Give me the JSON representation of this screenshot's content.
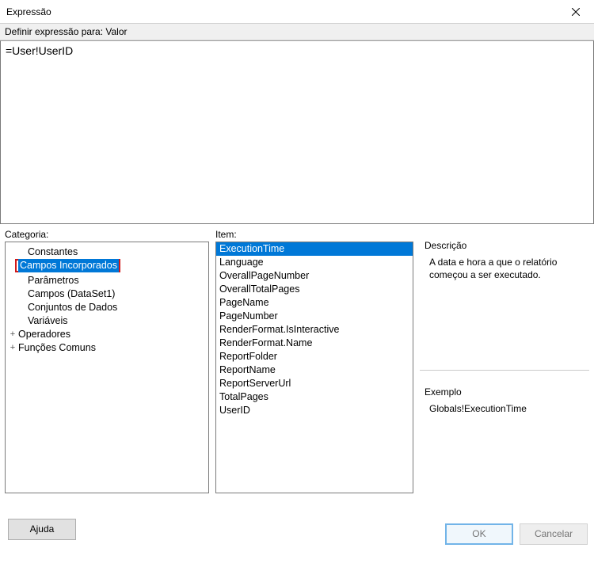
{
  "window": {
    "title": "Expressão"
  },
  "header": {
    "label": "Definir expressão para: Valor"
  },
  "expression": {
    "value": "=User!UserID"
  },
  "columns": {
    "category_label": "Categoria:",
    "item_label": "Item:"
  },
  "categories": {
    "items": [
      {
        "label": "Constantes",
        "indent": true
      },
      {
        "label": "Campos Incorporados",
        "indent": true,
        "selected": true,
        "highlighted": true
      },
      {
        "label": "Parâmetros",
        "indent": true
      },
      {
        "label": "Campos (DataSet1)",
        "indent": true
      },
      {
        "label": "Conjuntos de Dados",
        "indent": true
      },
      {
        "label": "Variáveis",
        "indent": true
      },
      {
        "label": "Operadores",
        "expander": "+"
      },
      {
        "label": "Funções Comuns",
        "expander": "+"
      }
    ]
  },
  "items": [
    {
      "label": "ExecutionTime",
      "selected": true
    },
    {
      "label": "Language"
    },
    {
      "label": "OverallPageNumber"
    },
    {
      "label": "OverallTotalPages"
    },
    {
      "label": "PageName"
    },
    {
      "label": "PageNumber"
    },
    {
      "label": "RenderFormat.IsInteractive"
    },
    {
      "label": "RenderFormat.Name"
    },
    {
      "label": "ReportFolder"
    },
    {
      "label": "ReportName"
    },
    {
      "label": "ReportServerUrl"
    },
    {
      "label": "TotalPages"
    },
    {
      "label": "UserID"
    }
  ],
  "description": {
    "title": "Descrição",
    "text": "A data e hora a que o relatório começou a ser executado."
  },
  "example": {
    "title": "Exemplo",
    "text": "Globals!ExecutionTime"
  },
  "buttons": {
    "help": "Ajuda",
    "ok": "OK",
    "cancel": "Cancelar"
  }
}
